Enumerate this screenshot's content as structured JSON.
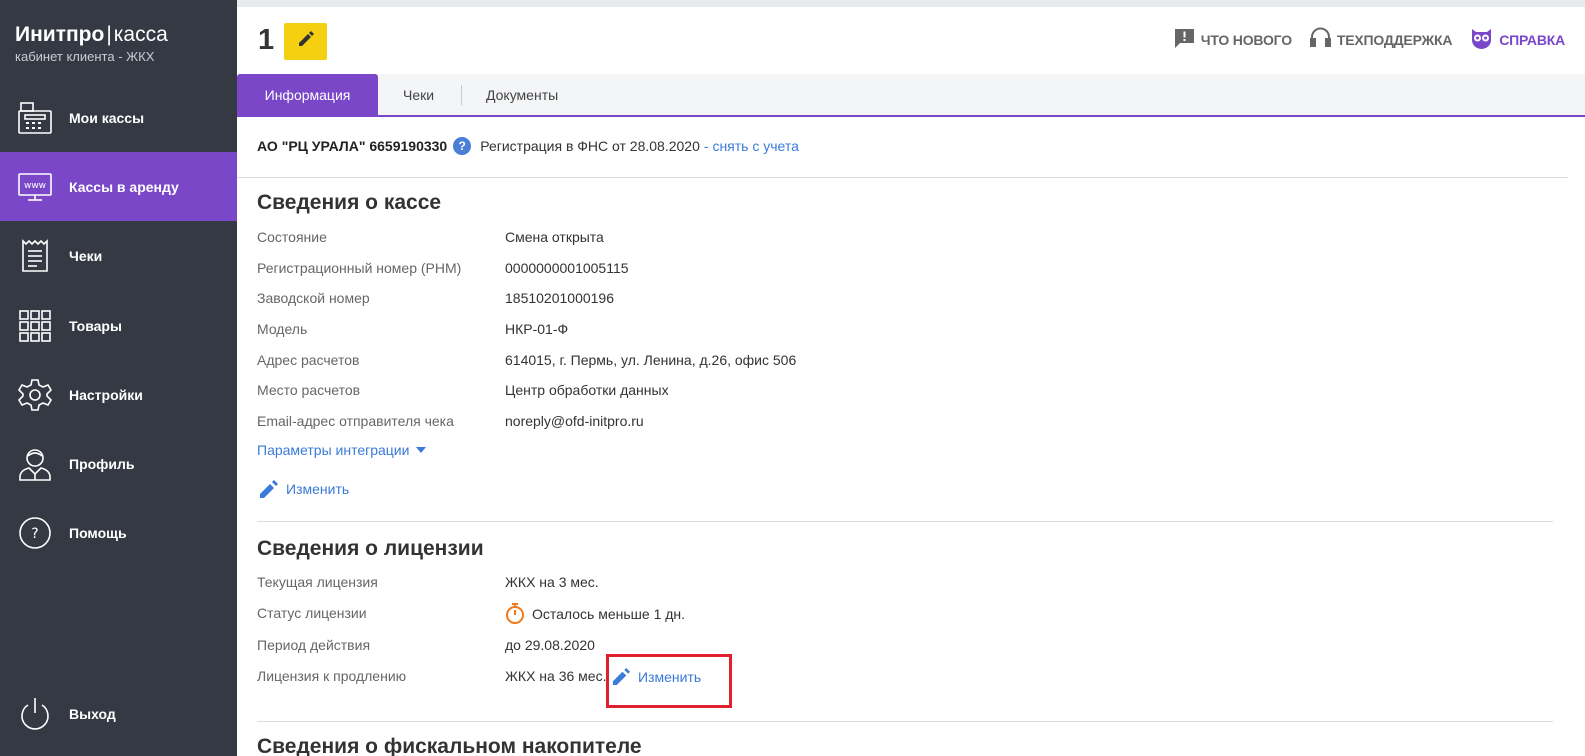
{
  "brand": {
    "name_bold": "Инитпро",
    "separator": "|",
    "name_light": "касса",
    "subtitle": "кабинет клиента - ЖКХ"
  },
  "sidebar": {
    "items": [
      {
        "label": "Мои кассы",
        "icon": "cash-register-icon"
      },
      {
        "label": "Кассы в аренду",
        "icon": "monitor-www-icon",
        "active": true
      },
      {
        "label": "Чеки",
        "icon": "receipt-icon"
      },
      {
        "label": "Товары",
        "icon": "grid-icon"
      },
      {
        "label": "Настройки",
        "icon": "gear-icon"
      },
      {
        "label": "Профиль",
        "icon": "user-icon"
      },
      {
        "label": "Помощь",
        "icon": "help-circle-icon"
      }
    ],
    "logout": {
      "label": "Выход",
      "icon": "power-icon"
    }
  },
  "header": {
    "page_number": "1",
    "links": {
      "news": "ЧТО НОВОГО",
      "support": "ТЕХПОДДЕРЖКА",
      "help": "СПРАВКА"
    }
  },
  "tabs": [
    {
      "label": "Информация",
      "active": true
    },
    {
      "label": "Чеки"
    },
    {
      "label": "Документы"
    }
  ],
  "org": {
    "name": "АО \"РЦ УРАЛА\" 6659190330",
    "help_glyph": "?",
    "registration": "Регистрация в ФНС от 28.08.2020",
    "unregister": "- снять с учета"
  },
  "kassa": {
    "title": "Сведения о кассе",
    "rows": [
      {
        "label": "Состояние",
        "value": "Смена открыта"
      },
      {
        "label": "Регистрационный номер (РНМ)",
        "value": "0000000001005115"
      },
      {
        "label": "Заводской номер",
        "value": "18510201000196"
      },
      {
        "label": "Модель",
        "value": "НКР-01-Ф"
      },
      {
        "label": "Адрес расчетов",
        "value": "614015, г. Пермь, ул. Ленина, д.26, офис 506"
      },
      {
        "label": "Место расчетов",
        "value": "Центр обработки данных"
      },
      {
        "label": "Email-адрес отправителя чека",
        "value": "noreply@ofd-initpro.ru"
      }
    ],
    "integration_params": "Параметры интеграции",
    "edit": "Изменить"
  },
  "license": {
    "title": "Сведения о лицензии",
    "current_label": "Текущая лицензия",
    "current_value": "ЖКХ на 3 мес.",
    "status_label": "Статус лицензии",
    "status_value": "Осталось меньше 1 дн.",
    "period_label": "Период действия",
    "period_value": "до 29.08.2020",
    "renewal_label": "Лицензия к продлению",
    "renewal_value": "ЖКХ на 36 мес.",
    "renewal_edit": "Изменить",
    "status_color": "#f07a1a"
  },
  "next_section_title": "Сведения о фискальном накопителе",
  "colors": {
    "sidebar_bg": "#353944",
    "accent": "#7a47c9",
    "link": "#3a7ad8",
    "edit_button": "#f4d010",
    "highlight": "#e0202e"
  }
}
